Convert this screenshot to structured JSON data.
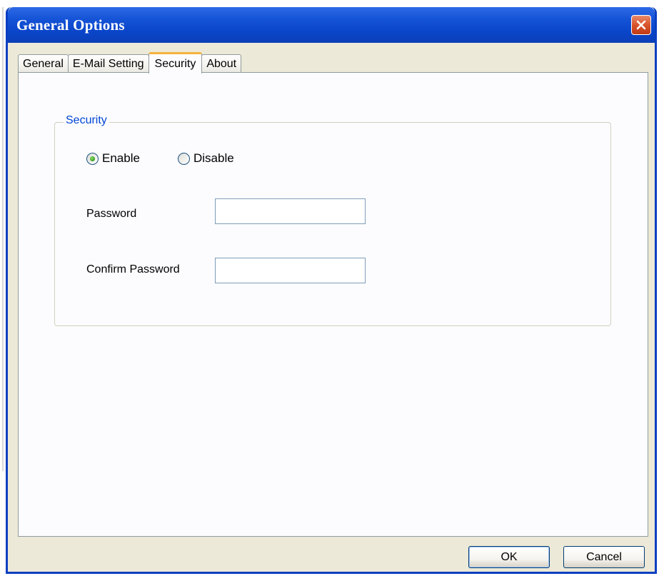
{
  "window": {
    "title": "General Options",
    "close_icon": "close-icon"
  },
  "tabs": [
    {
      "label": "General",
      "active": false
    },
    {
      "label": "E-Mail Setting",
      "active": false
    },
    {
      "label": "Security",
      "active": true
    },
    {
      "label": "About",
      "active": false
    }
  ],
  "security": {
    "group_label": "Security",
    "enable_label": "Enable",
    "disable_label": "Disable",
    "selected": "Enable",
    "password_label": "Password",
    "password_value": "",
    "confirm_label": "Confirm Password",
    "confirm_value": ""
  },
  "buttons": {
    "ok_label": "OK",
    "cancel_label": "Cancel"
  },
  "colors": {
    "titlebar": "#0a45c9",
    "close_button": "#d9532c",
    "active_tab_accent": "#f5b33b",
    "group_label": "#0046d5",
    "radio_checked": "#3fa32a"
  }
}
